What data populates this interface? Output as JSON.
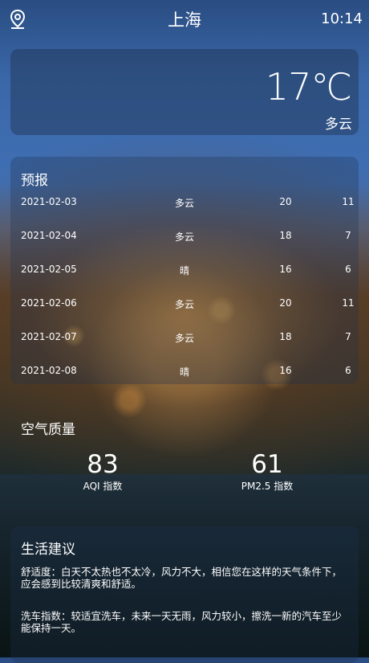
{
  "header": {
    "city": "上海",
    "time": "10:14",
    "location_icon": "location-pin-icon"
  },
  "now": {
    "temperature": "17℃",
    "condition": "多云"
  },
  "forecast": {
    "title": "预报",
    "rows": [
      {
        "date": "2021-02-03",
        "weather": "多云",
        "high": "20",
        "low": "11"
      },
      {
        "date": "2021-02-04",
        "weather": "多云",
        "high": "18",
        "low": "7"
      },
      {
        "date": "2021-02-05",
        "weather": "晴",
        "high": "16",
        "low": "6"
      },
      {
        "date": "2021-02-06",
        "weather": "多云",
        "high": "20",
        "low": "11"
      },
      {
        "date": "2021-02-07",
        "weather": "多云",
        "high": "18",
        "low": "7"
      },
      {
        "date": "2021-02-08",
        "weather": "晴",
        "high": "16",
        "low": "6"
      }
    ]
  },
  "air_quality": {
    "title": "空气质量",
    "aqi": {
      "value": "83",
      "label": "AQI 指数"
    },
    "pm25": {
      "value": "61",
      "label": "PM2.5 指数"
    }
  },
  "suggestions": {
    "title": "生活建议",
    "comfort": "舒适度：白天不太热也不太冷，风力不大，相信您在这样的天气条件下，应会感到比较清爽和舒适。",
    "car_wash": "洗车指数：较适宜洗车，未来一天无雨，风力较小，擦洗一新的汽车至少能保持一天。"
  }
}
